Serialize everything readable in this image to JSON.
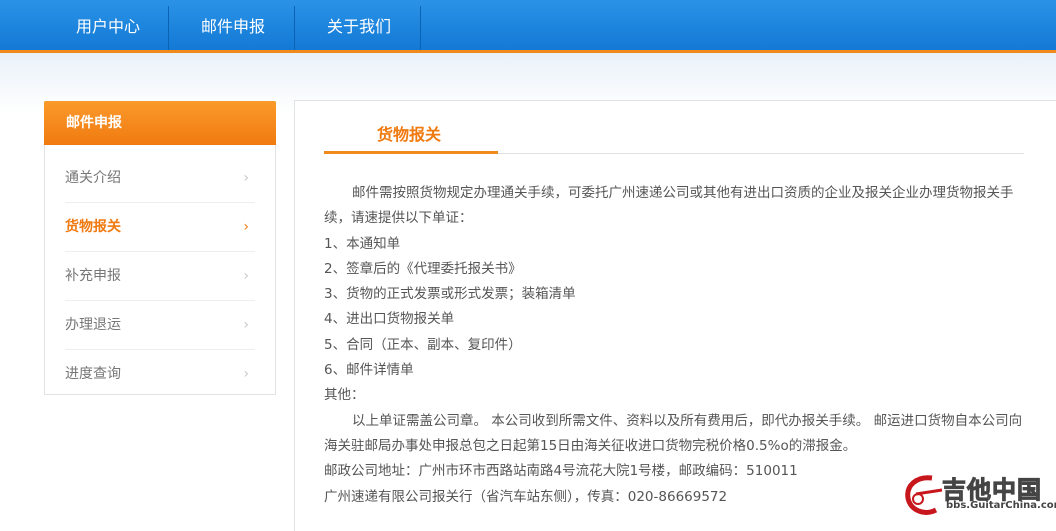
{
  "nav": {
    "items": [
      "用户中心",
      "邮件申报",
      "关于我们"
    ]
  },
  "sidebar": {
    "header": "邮件申报",
    "items": [
      {
        "label": "通关介绍",
        "active": false
      },
      {
        "label": "货物报关",
        "active": true
      },
      {
        "label": "补充申报",
        "active": false
      },
      {
        "label": "办理退运",
        "active": false
      },
      {
        "label": "进度查询",
        "active": false
      }
    ],
    "chevron": "›"
  },
  "main": {
    "title": "货物报关",
    "paragraphs": [
      "邮件需按照货物规定办理通关手续，可委托广州速递公司或其他有进出口资质的企业及报关企业办理货物报关手续，请速提供以下单证：",
      "1、本通知单",
      "2、签章后的《代理委托报关书》",
      "3、货物的正式发票或形式发票；装箱清单",
      "4、进出口货物报关单",
      "5、合同（正本、副本、复印件）",
      "6、邮件详情单",
      "其他：",
      "以上单证需盖公司章。 本公司收到所需文件、资料以及所有费用后，即代办报关手续。 邮运进口货物自本公司向海关驻邮局办事处申报总包之日起第15日由海关征收进口货物完税价格0.5%o的滞报金。",
      "邮政公司地址：广州市环市西路站南路4号流花大院1号楼，邮政编码：510011",
      "广州速递有限公司报关行（省汽车站东侧），传真：020-86669572"
    ]
  },
  "watermark": {
    "main": "吉他中国",
    "sub": "bbs.GuitarChina.com"
  },
  "colors": {
    "nav": "#1a85de",
    "accent": "#f08a1c"
  }
}
